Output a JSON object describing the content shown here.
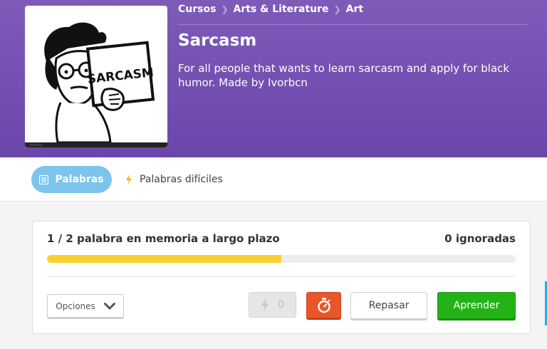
{
  "breadcrumb": [
    "Cursos",
    "Arts & Literature",
    "Art"
  ],
  "course": {
    "title": "Sarcasm",
    "description": "For all people that wants to learn sarcasm and apply for black humor. Made by Ivorbcn",
    "image_sign_text": "SARCASM",
    "image_footer": "Unofficial"
  },
  "tabs": {
    "words": "Palabras",
    "difficult_words": "Palabras difíciles"
  },
  "progress": {
    "summary": "1 / 2 palabra en memoria a largo plazo",
    "ignored": "0 ignoradas",
    "fraction": 0.5
  },
  "actions": {
    "options": "Opciones",
    "speed_count": "0",
    "review": "Repasar",
    "learn": "Aprender"
  },
  "colors": {
    "header": "#7a55b6",
    "tab_active": "#7cc4ec",
    "progress_fill": "#f8d12f",
    "timer": "#e9562a",
    "learn": "#24b317"
  },
  "icons": {
    "words_tab": "list-icon",
    "difficult_tab": "bolt-icon",
    "options": "chevron-down-icon",
    "speed": "bolt-icon",
    "timer": "stopwatch-icon"
  }
}
